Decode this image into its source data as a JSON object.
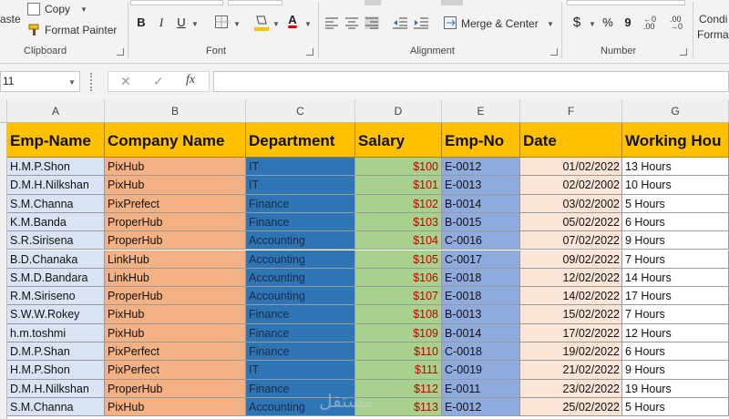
{
  "ribbon": {
    "clipboard": {
      "paste": "aste",
      "copy": "Copy",
      "format_painter": "Format Painter",
      "label": "Clipboard"
    },
    "font": {
      "label": "Font",
      "bold": "B",
      "italic": "I",
      "underline": "U",
      "font_color_glyph": "A"
    },
    "alignment": {
      "label": "Alignment",
      "merge_center": "Merge & Center"
    },
    "number": {
      "label": "Number",
      "currency": "$",
      "percent": "%",
      "comma": "9"
    },
    "styles": {
      "conditional_line1": "Condi",
      "conditional_line2": "Forma"
    }
  },
  "formula_bar": {
    "name_box": "11",
    "cancel": "✕",
    "enter": "✓",
    "fx": "fx",
    "value": ""
  },
  "columns": [
    "A",
    "B",
    "C",
    "D",
    "E",
    "F",
    "G"
  ],
  "header_row": [
    "Emp-Name",
    "Company Name",
    "Department",
    "Salary",
    "Emp-No",
    "Date",
    "Working Hou"
  ],
  "rows": [
    [
      "H.M.P.Shon",
      "PixHub",
      "IT",
      "$100",
      "E-0012",
      "01/02/2022",
      "13 Hours"
    ],
    [
      "D.M.H.Nilkshan",
      "PixHub",
      "IT",
      "$101",
      "E-0013",
      "02/02/2002",
      "10 Hours"
    ],
    [
      "S.M.Channa",
      "PixPrefect",
      "Finance",
      "$102",
      "B-0014",
      "03/02/2002",
      "5 Hours"
    ],
    [
      "K.M.Banda",
      "ProperHub",
      "Finance",
      "$103",
      "B-0015",
      "05/02/2022",
      "6 Hours"
    ],
    [
      "S.R.Sirisena",
      "ProperHub",
      "Accounting",
      "$104",
      "C-0016",
      "07/02/2022",
      "9 Hours"
    ],
    [
      "B.D.Chanaka",
      "LinkHub",
      "Accounting",
      "$105",
      "C-0017",
      "09/02/2022",
      "7 Hours"
    ],
    [
      "S.M.D.Bandara",
      "LinkHub",
      "Accounting",
      "$106",
      "E-0018",
      "12/02/2022",
      "14 Hours"
    ],
    [
      "R.M.Siriseno",
      "ProperHub",
      "Accounting",
      "$107",
      "E-0018",
      "14/02/2022",
      "17 Hours"
    ],
    [
      "S.W.W.Rokey",
      "PixHub",
      "Finance",
      "$108",
      "B-0013",
      "15/02/2022",
      "7 Hours"
    ],
    [
      "h.m.toshmi",
      "PixHub",
      "Finance",
      "$109",
      "B-0014",
      "17/02/2022",
      "12 Hours"
    ],
    [
      "D.M.P.Shan",
      "PixPerfect",
      "Finance",
      "$110",
      "C-0018",
      "19/02/2022",
      "6 Hours"
    ],
    [
      "H.M.P.Shon",
      "PixPerfect",
      "IT",
      "$111",
      "C-0019",
      "21/02/2022",
      "9 Hours"
    ],
    [
      "D.M.H.Nilkshan",
      "ProperHub",
      "Finance",
      "$112",
      "E-0011",
      "23/02/2022",
      "19 Hours"
    ],
    [
      "S.M.Channa",
      "PixHub",
      "Accounting",
      "$113",
      "E-0012",
      "25/02/2022",
      "5 Hours"
    ]
  ],
  "colors": {
    "header_fill": "#ffc000",
    "emp_name_fill": "#dae3f3",
    "company_fill": "#f4b183",
    "department_fill": "#2e75b6",
    "salary_fill": "#a9d18e",
    "salary_text": "#c00000",
    "emp_no_fill": "#8faadc",
    "date_fill": "#fbe5d6"
  },
  "watermark": "مستقل"
}
